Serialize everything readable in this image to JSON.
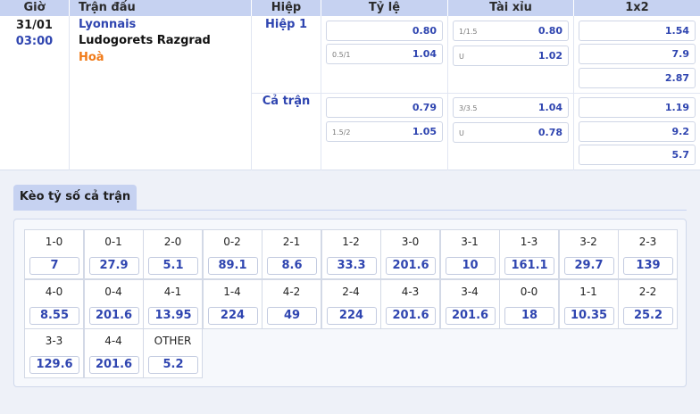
{
  "header": {
    "columns": [
      "Giờ",
      "Trận đấu",
      "Hiệp",
      "Tỷ lệ",
      "Tài xỉu",
      "1x2"
    ]
  },
  "match": {
    "date": "31/01",
    "time": "03:00",
    "home": "Lyonnais",
    "away": "Ludogorets Razgrad",
    "draw": "Hoà",
    "periods": [
      {
        "label": "Hiệp 1",
        "handicap": [
          {
            "line": "",
            "value": "0.80"
          },
          {
            "line": "0.5/1",
            "value": "1.04"
          }
        ],
        "overunder": [
          {
            "line": "1/1.5",
            "value": "0.80"
          },
          {
            "line": "U",
            "value": "1.02"
          }
        ],
        "x12": [
          "1.54",
          "7.9",
          "2.87"
        ]
      },
      {
        "label": "Cả trận",
        "handicap": [
          {
            "line": "",
            "value": "0.79"
          },
          {
            "line": "1.5/2",
            "value": "1.05"
          }
        ],
        "overunder": [
          {
            "line": "3/3.5",
            "value": "1.04"
          },
          {
            "line": "U",
            "value": "0.78"
          }
        ],
        "x12": [
          "1.19",
          "9.2",
          "5.7"
        ]
      }
    ]
  },
  "correct_score": {
    "tab_label": "Kèo tỷ số cả trận",
    "scores": [
      {
        "label": "1-0",
        "odd": "7"
      },
      {
        "label": "0-1",
        "odd": "27.9"
      },
      {
        "label": "2-0",
        "odd": "5.1"
      },
      {
        "label": "0-2",
        "odd": "89.1"
      },
      {
        "label": "2-1",
        "odd": "8.6"
      },
      {
        "label": "1-2",
        "odd": "33.3"
      },
      {
        "label": "3-0",
        "odd": "201.6"
      },
      {
        "label": "3-1",
        "odd": "10"
      },
      {
        "label": "1-3",
        "odd": "161.1"
      },
      {
        "label": "3-2",
        "odd": "29.7"
      },
      {
        "label": "2-3",
        "odd": "139"
      },
      {
        "label": "4-0",
        "odd": "8.55"
      },
      {
        "label": "0-4",
        "odd": "201.6"
      },
      {
        "label": "4-1",
        "odd": "13.95"
      },
      {
        "label": "1-4",
        "odd": "224"
      },
      {
        "label": "4-2",
        "odd": "49"
      },
      {
        "label": "2-4",
        "odd": "224"
      },
      {
        "label": "4-3",
        "odd": "201.6"
      },
      {
        "label": "3-4",
        "odd": "201.6"
      },
      {
        "label": "0-0",
        "odd": "18"
      },
      {
        "label": "1-1",
        "odd": "10.35"
      },
      {
        "label": "2-2",
        "odd": "25.2"
      },
      {
        "label": "3-3",
        "odd": "129.6"
      },
      {
        "label": "4-4",
        "odd": "201.6"
      },
      {
        "label": "OTHER",
        "odd": "5.2"
      }
    ]
  },
  "colors": {
    "header_bg": "#c6d2f1",
    "odds_blue": "#2f45b0",
    "draw_orange": "#f07a18"
  }
}
